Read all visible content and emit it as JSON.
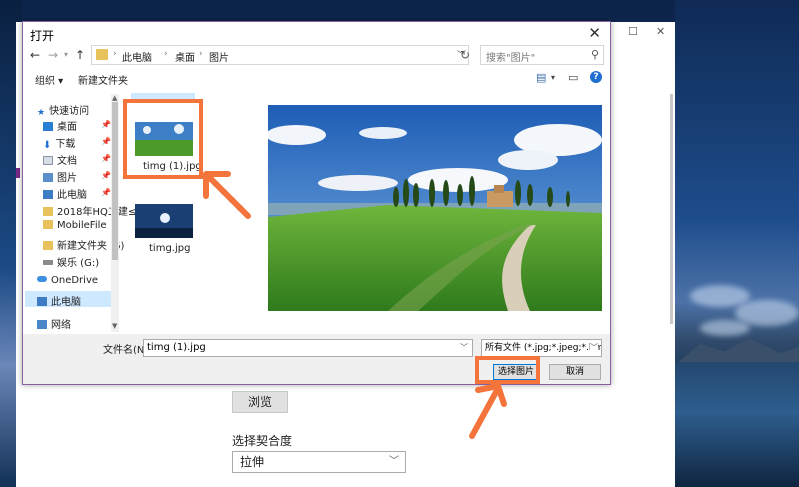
{
  "dialog": {
    "title": "打开",
    "close_icon": "close-icon",
    "breadcrumbs": [
      "此电脑",
      "桌面",
      "图片"
    ],
    "search_placeholder": "搜索\"图片\"",
    "toolbar": {
      "organize": "组织 ▾",
      "new_folder": "新建文件夹"
    },
    "nav_items": [
      {
        "label": "快速访问",
        "icon": "star-icon"
      },
      {
        "label": "桌面",
        "icon": "desktop-icon",
        "pinned": true
      },
      {
        "label": "下载",
        "icon": "download-icon",
        "pinned": true
      },
      {
        "label": "文档",
        "icon": "document-icon",
        "pinned": true
      },
      {
        "label": "图片",
        "icon": "picture-icon",
        "pinned": true
      },
      {
        "label": "此电脑",
        "icon": "computer-icon",
        "pinned": true
      },
      {
        "label": "2018年HQ二建≤",
        "icon": "folder-icon"
      },
      {
        "label": "MobileFile",
        "icon": "folder-icon"
      },
      {
        "label": "新建文件夹 (6)",
        "icon": "folder-icon"
      },
      {
        "label": "娱乐 (G:)",
        "icon": "drive-icon"
      },
      {
        "label": "OneDrive",
        "icon": "cloud-icon"
      },
      {
        "label": "此电脑",
        "icon": "computer-icon",
        "selected": true
      },
      {
        "label": "网络",
        "icon": "network-icon"
      }
    ],
    "files": [
      {
        "name": "timg (1).jpg",
        "selected": true
      },
      {
        "name": "timg.jpg"
      }
    ],
    "filename_label": "文件名(N):",
    "filename_value": "timg (1).jpg",
    "filetype_value": "所有文件 (*.jpg;*.jpeg;*.bmp;*.",
    "ok_label": "选择图片",
    "cancel_label": "取消"
  },
  "parent": {
    "browse_label": "浏览",
    "match_label": "选择契合度",
    "match_value": "拉伸"
  },
  "colors": {
    "accent": "#f4743b",
    "selection": "#cde8ff",
    "dialog_border": "#8a5fa0"
  }
}
